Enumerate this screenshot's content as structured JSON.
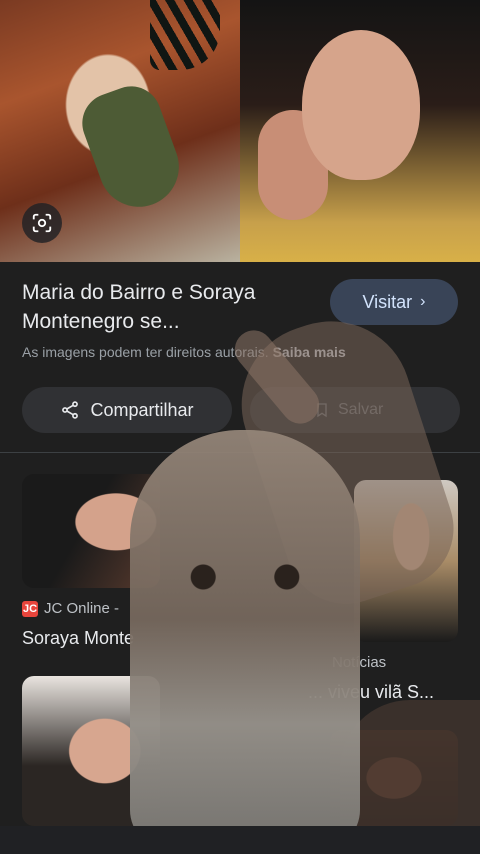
{
  "hero": {
    "lens_icon": "google-lens-icon"
  },
  "result": {
    "title": "Maria do Bairro e Soraya Montenegro se...",
    "visit_label": "Visitar",
    "rights_text": "As imagens podem ter direitos autorais.",
    "learn_more": "Saiba mais"
  },
  "actions": {
    "share_label": "Compartilhar",
    "save_label": "Salvar"
  },
  "related": {
    "item1": {
      "source": "JC Online -",
      "caption": "Soraya Monte"
    },
    "item2": {
      "source": "Notícias",
      "caption": "... viveu vilã S..."
    }
  },
  "colors": {
    "background": "#1f1f1f",
    "chip": "#303134",
    "visit_button": "#394457",
    "visit_text": "#d2e3fc"
  }
}
